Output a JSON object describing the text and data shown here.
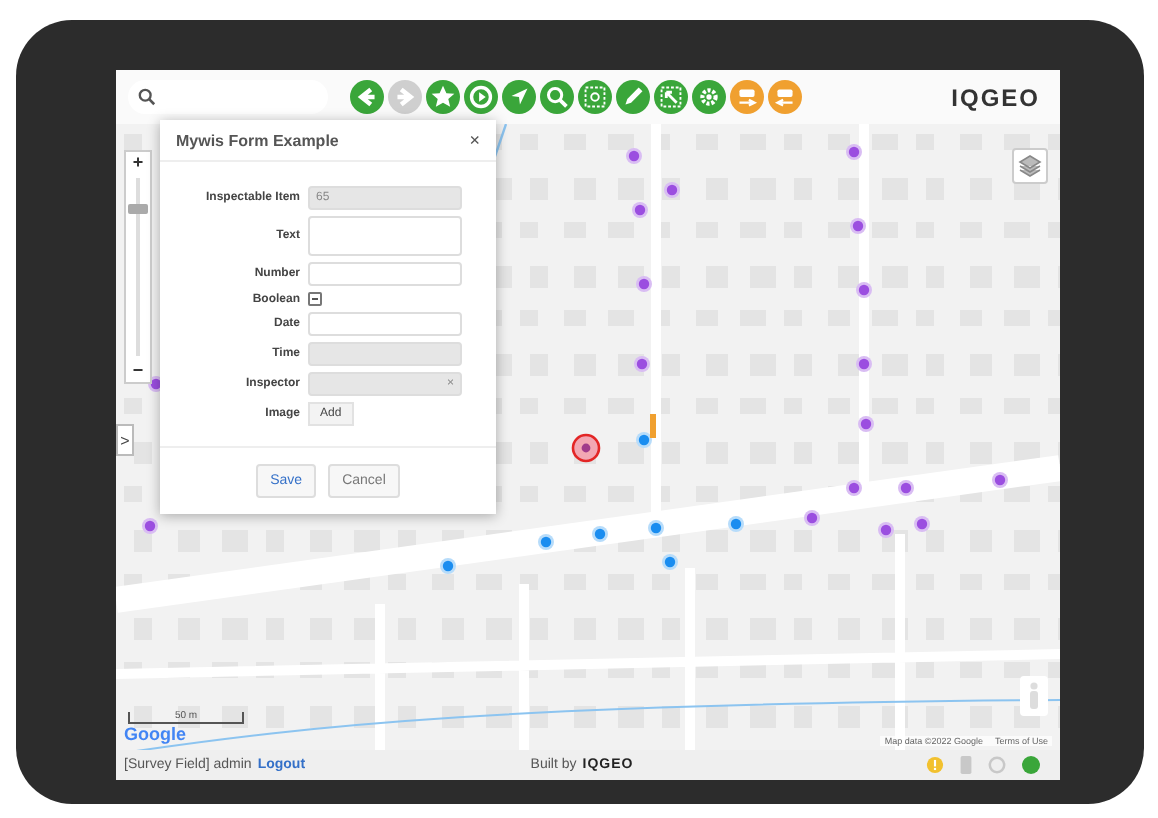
{
  "toolbar": [
    {
      "kind": "back",
      "disabled": false
    },
    {
      "kind": "forward",
      "disabled": true
    },
    {
      "kind": "star",
      "disabled": false
    },
    {
      "kind": "play",
      "disabled": false
    },
    {
      "kind": "navigate",
      "disabled": false
    },
    {
      "kind": "zoom",
      "disabled": false
    },
    {
      "kind": "zoom-box",
      "disabled": false
    },
    {
      "kind": "pencil",
      "disabled": false
    },
    {
      "kind": "select-box",
      "disabled": false
    },
    {
      "kind": "gear",
      "disabled": false
    },
    {
      "kind": "sim-in",
      "disabled": false
    },
    {
      "kind": "sim-out",
      "disabled": false
    }
  ],
  "logo": "IQGEO",
  "zoom_control": {
    "plus": "+",
    "minus": "−",
    "level": 0.85
  },
  "dialog": {
    "title": "Mywis Form Example",
    "close": "×",
    "fields": [
      {
        "kind": "text",
        "label": "Inspectable Item",
        "value": "65",
        "disabled": true
      },
      {
        "kind": "textarea",
        "label": "Text",
        "disabled": false
      },
      {
        "kind": "text",
        "label": "Number",
        "disabled": false
      },
      {
        "kind": "checkbox",
        "label": "Boolean",
        "indeterminate": true
      },
      {
        "kind": "text",
        "label": "Date",
        "disabled": false
      },
      {
        "kind": "text",
        "label": "Time",
        "disabled": true
      },
      {
        "kind": "select",
        "label": "Inspector",
        "clear": "×",
        "disabled": true
      },
      {
        "kind": "button",
        "label": "Image",
        "button": "Add"
      }
    ],
    "buttons": [
      {
        "label": "Save",
        "primary": true
      },
      {
        "label": "Cancel",
        "primary": false
      }
    ]
  },
  "side_toggle": ">",
  "map": {
    "scale": "50 m",
    "google": "Google",
    "attribution": "Map data ©2022 Google",
    "terms": "Terms of Use"
  },
  "status_bar": {
    "user": "[Survey Field] admin",
    "logout": "Logout",
    "built_by": "Built by",
    "brand": "IQGEO",
    "indicators": [
      {
        "kind": "alert",
        "color": "#f2c12e"
      },
      {
        "kind": "gauge",
        "color": "#c8c8c8"
      },
      {
        "kind": "ring",
        "color": "#c8c8c8"
      },
      {
        "kind": "dot",
        "color": "#3aa63a"
      }
    ]
  }
}
